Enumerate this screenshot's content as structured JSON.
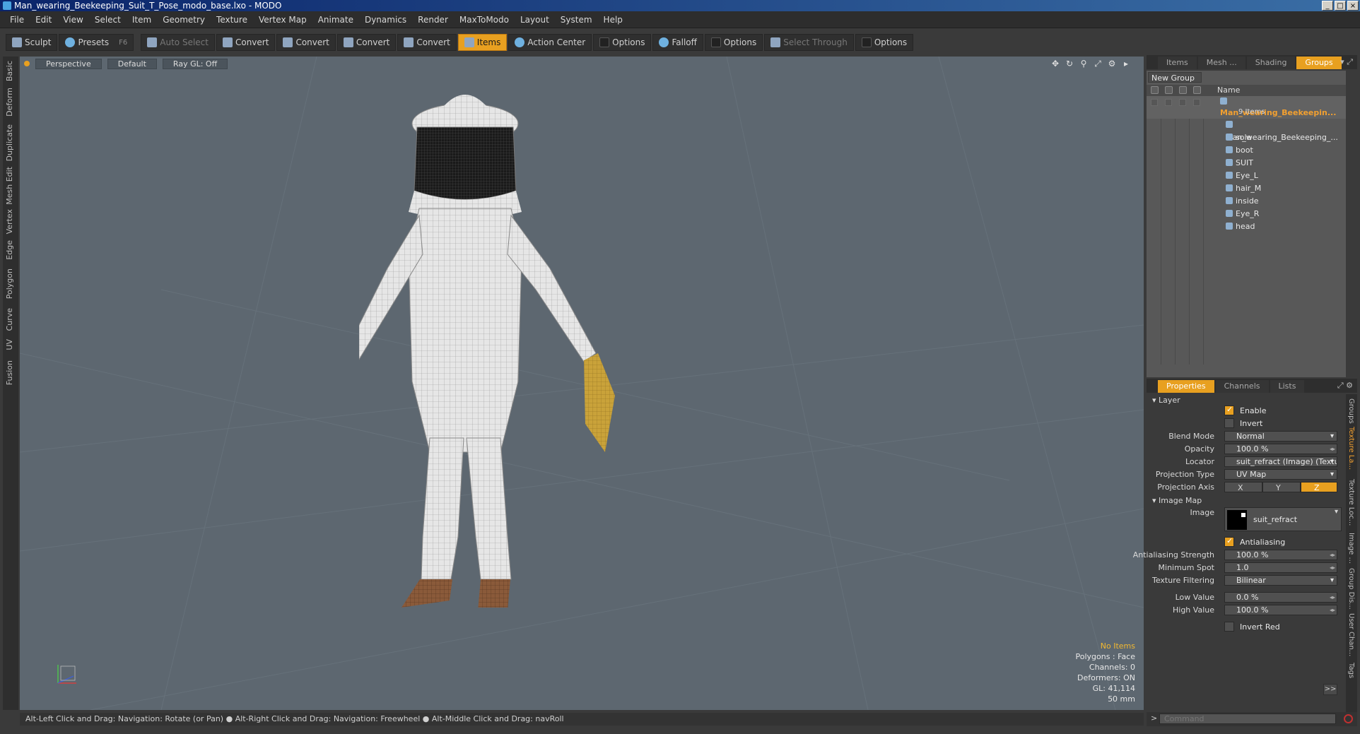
{
  "window": {
    "title": "Man_wearing_Beekeeping_Suit_T_Pose_modo_base.lxo - MODO"
  },
  "menu": [
    "File",
    "Edit",
    "View",
    "Select",
    "Item",
    "Geometry",
    "Texture",
    "Vertex Map",
    "Animate",
    "Dynamics",
    "Render",
    "MaxToModo",
    "Layout",
    "System",
    "Help"
  ],
  "toolbar": {
    "sculpt": "Sculpt",
    "presets": "Presets",
    "presets_key": "F6",
    "auto_select": "Auto Select",
    "convert1": "Convert",
    "convert2": "Convert",
    "convert3": "Convert",
    "convert4": "Convert",
    "items": "Items",
    "action_center": "Action Center",
    "options1": "Options",
    "falloff": "Falloff",
    "options2": "Options",
    "select_through": "Select Through",
    "options3": "Options"
  },
  "left_tabs": [
    "Basic",
    "Deform",
    "Duplicate",
    "Mesh Edit",
    "Vertex",
    "Edge",
    "Polygon",
    "Curve",
    "UV",
    "Fusion"
  ],
  "viewport": {
    "perspective": "Perspective",
    "default": "Default",
    "raygl": "Ray GL: Off",
    "info": {
      "items": "No Items",
      "polygons": "Polygons : Face",
      "channels": "Channels: 0",
      "deformers": "Deformers: ON",
      "gl": "GL: 41,114",
      "focal": "50 mm"
    }
  },
  "status": "Alt-Left Click and Drag: Navigation: Rotate (or Pan) ● Alt-Right Click and Drag: Navigation: Freewheel ● Alt-Middle Click and Drag: navRoll",
  "top_tabs": [
    "Items",
    "Mesh ...",
    "Shading",
    "Groups"
  ],
  "groups": {
    "new_group": "New Group",
    "col_name": "Name",
    "root_name": "Man_wearing_Beekeepin...",
    "root_count": "9 Items",
    "items": [
      "Man_wearing_Beekeeping_...",
      "sole",
      "boot",
      "SUIT",
      "Eye_L",
      "hair_M",
      "inside",
      "Eye_R",
      "head"
    ]
  },
  "props_tabs": [
    "Properties",
    "Channels",
    "Lists"
  ],
  "properties": {
    "layer_section": "Layer",
    "enable": "Enable",
    "invert": "Invert",
    "blend_mode_label": "Blend Mode",
    "blend_mode": "Normal",
    "opacity_label": "Opacity",
    "opacity": "100.0 %",
    "locator_label": "Locator",
    "locator": "suit_refract (Image) (Texture)",
    "projection_type_label": "Projection Type",
    "projection_type": "UV Map",
    "projection_axis_label": "Projection Axis",
    "axis_x": "X",
    "axis_y": "Y",
    "axis_z": "Z",
    "image_map_section": "Image Map",
    "image_label": "Image",
    "image": "suit_refract",
    "antialiasing": "Antialiasing",
    "aa_strength_label": "Antialiasing Strength",
    "aa_strength": "100.0 %",
    "min_spot_label": "Minimum Spot",
    "min_spot": "1.0",
    "tex_filter_label": "Texture Filtering",
    "tex_filter": "Bilinear",
    "low_value_label": "Low Value",
    "low_value": "0.0 %",
    "high_value_label": "High Value",
    "high_value": "100.0 %",
    "invert_red": "Invert Red",
    "more": ">>"
  },
  "right_vtabs": [
    "Groups",
    "Texture La...",
    "Texture Loc...",
    "Image ...",
    "Group Dis...",
    "User Chan...",
    "Tags"
  ],
  "command": {
    "placeholder": "Command"
  }
}
